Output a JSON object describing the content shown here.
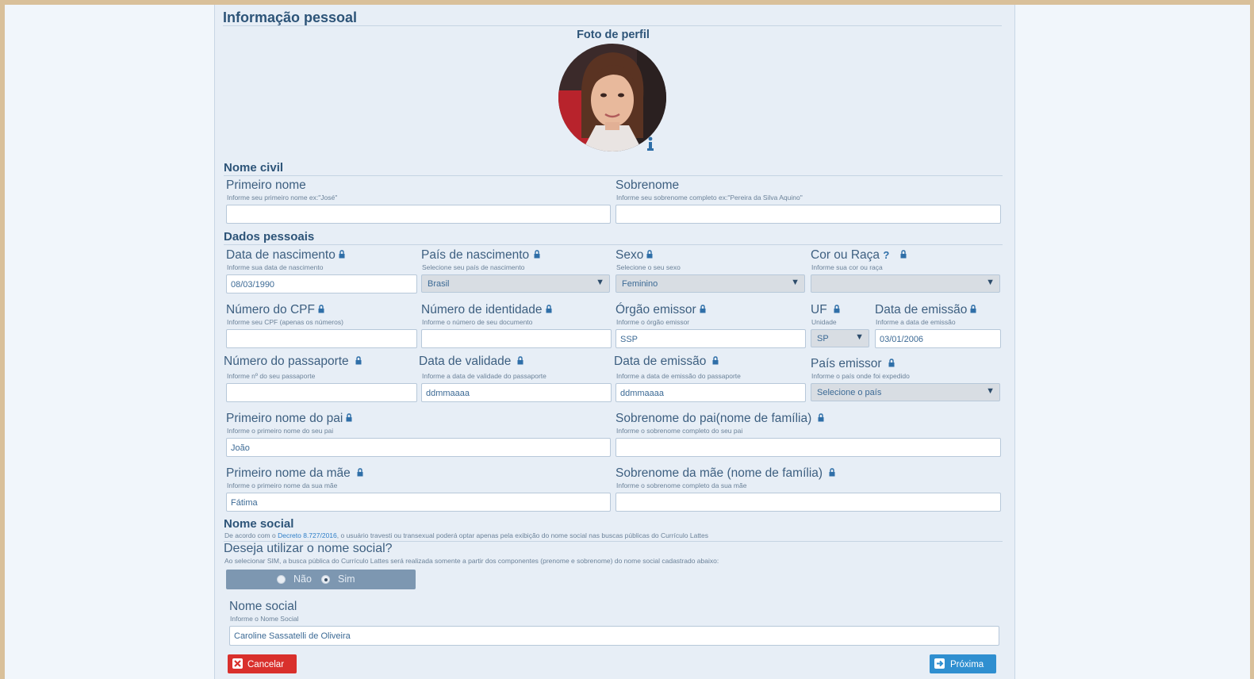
{
  "section_title": "Informação pessoal",
  "photo": {
    "label": "Foto de perfil"
  },
  "nome_civil": {
    "title": "Nome civil",
    "primeiro_nome": {
      "label": "Primeiro nome",
      "hint": "Informe seu primeiro nome ex:\"José\"",
      "value": ""
    },
    "sobrenome": {
      "label": "Sobrenome",
      "hint": "Informe seu sobrenome completo ex:\"Pereira da Silva Aquino\"",
      "value": ""
    }
  },
  "dados_pessoais": {
    "title": "Dados pessoais",
    "nascimento": {
      "label": "Data de nascimento",
      "hint": "Informe sua data de nascimento",
      "value": "08/03/1990"
    },
    "pais_nascimento": {
      "label": "País de nascimento",
      "hint": "Selecione seu país de nascimento",
      "value": "Brasil"
    },
    "sexo": {
      "label": "Sexo",
      "hint": "Selecione o seu sexo",
      "value": "Feminino"
    },
    "cor_raca": {
      "label": "Cor ou Raça",
      "help": "?",
      "hint": "Informe sua cor ou raça",
      "value": ""
    },
    "cpf": {
      "label": "Número do CPF",
      "hint": "Informe seu CPF (apenas os números)",
      "value": ""
    },
    "identidade": {
      "label": "Número de identidade",
      "hint": "Informe o número de seu documento",
      "value": ""
    },
    "orgao": {
      "label": "Órgão emissor",
      "hint": "Informe o órgão emissor",
      "value": "SSP"
    },
    "uf": {
      "label": "UF",
      "hint": "Unidade",
      "value": "SP"
    },
    "data_emissao_id": {
      "label": "Data de emissão",
      "hint": "Informe a data de emissão",
      "value": "03/01/2006"
    },
    "passaporte": {
      "label": "Número do passaporte",
      "hint": "Informe nº do seu passaporte",
      "value": ""
    },
    "validade": {
      "label": "Data de validade",
      "hint": "Informe a data de validade do passaporte",
      "value": "ddmmaaaa"
    },
    "data_emissao_pass": {
      "label": "Data de emissão",
      "hint": "Informe a data de emissão do passaporte",
      "value": "ddmmaaaa"
    },
    "pais_emissor": {
      "label": "País emissor",
      "hint": "Informe o país onde foi expedido",
      "value": "Selecione o país"
    },
    "pai_nome": {
      "label": "Primeiro nome do pai",
      "hint": "Informe o primeiro nome do seu pai",
      "value": "João"
    },
    "pai_sobrenome": {
      "label": "Sobrenome do pai(nome de família)",
      "hint": "Informe o sobrenome completo do seu pai",
      "value": ""
    },
    "mae_nome": {
      "label": "Primeiro nome da mãe",
      "hint": "Informe o primeiro nome da sua mãe",
      "value": "Fátima"
    },
    "mae_sobrenome": {
      "label": "Sobrenome da mãe (nome de família)",
      "hint": "Informe o sobrenome completo da sua mãe",
      "value": ""
    }
  },
  "nome_social": {
    "title": "Nome social",
    "note_pre": "De acordo com o ",
    "note_link": "Decreto 8.727/2016",
    "note_post": ", o usuário travesti ou transexual poderá optar apenas pela exibição do nome social nas buscas públicas do Currículo Lattes",
    "question": "Deseja utilizar o nome social?",
    "question_hint": "Ao selecionar SIM, a busca pública do Currículo Lattes será realizada somente a partir dos componentes (prenome e sobrenome) do nome social cadastrado abaixo:",
    "options": [
      "Não",
      "Sim"
    ],
    "selected": "Sim",
    "field": {
      "label": "Nome social",
      "hint": "Informe o Nome Social",
      "value": "Caroline Sassatelli de Oliveira"
    }
  },
  "buttons": {
    "cancel": "Cancelar",
    "next": "Próxima"
  },
  "colors": {
    "cancel": "#d9302c",
    "next": "#2f8fd0",
    "accent": "#2d5478"
  }
}
